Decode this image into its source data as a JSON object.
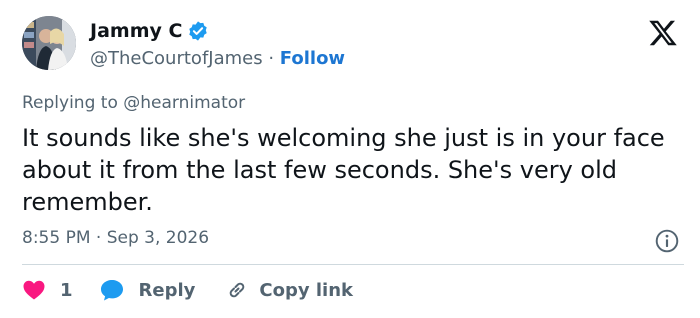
{
  "author": {
    "display_name": "Jammy C",
    "handle": "@TheCourtofJames",
    "separator": "·",
    "follow_label": "Follow",
    "verified_icon": "verified-badge-icon",
    "verified_color": "#1d9bf0"
  },
  "reply_context": {
    "prefix": "Replying to",
    "handle": "@hearnimator"
  },
  "tweet": {
    "text": "It sounds like she's welcoming she just is in your face about it from the last few seconds. She's very old remember.",
    "time": "8:55 PM",
    "separator": "·",
    "date": "Sep 3, 2026"
  },
  "actions": {
    "like_count": "1",
    "reply_label": "Reply",
    "copy_label": "Copy link",
    "like_color": "#f91880",
    "reply_color": "#1d9bf0"
  },
  "icons": {
    "logo": "x-logo-icon",
    "info": "info-icon",
    "like": "heart-icon",
    "reply": "chat-bubble-icon",
    "copy": "link-icon"
  }
}
